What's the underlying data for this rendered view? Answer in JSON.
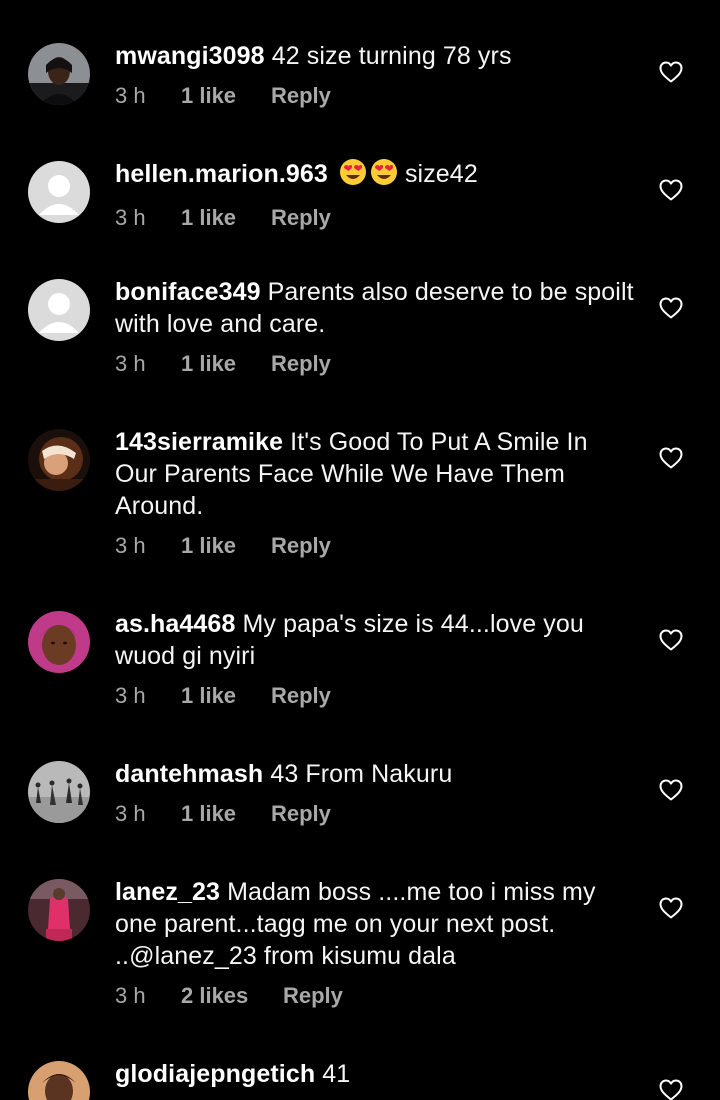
{
  "comments": [
    {
      "username": "mwangi3098",
      "text": "42 size turning 78 yrs",
      "time": "3 h",
      "likes": "1 like",
      "reply": "Reply",
      "avatar_icon": "profile-photo"
    },
    {
      "username": "hellen.marion.963",
      "text": "size42",
      "emojis": [
        "heart-eyes-emoji",
        "heart-eyes-emoji"
      ],
      "time": "3 h",
      "likes": "1 like",
      "reply": "Reply",
      "avatar_icon": "default-avatar"
    },
    {
      "username": "boniface349",
      "text": "Parents also deserve to be spoilt with love and care.",
      "time": "3 h",
      "likes": "1 like",
      "reply": "Reply",
      "avatar_icon": "default-avatar"
    },
    {
      "username": "143sierramike",
      "text": "It's Good To Put A Smile In Our Parents Face While We Have Them Around.",
      "time": "3 h",
      "likes": "1 like",
      "reply": "Reply",
      "avatar_icon": "profile-photo"
    },
    {
      "username": "as.ha4468",
      "text": "My papa's size is 44...love you wuod gi nyiri",
      "time": "3 h",
      "likes": "1 like",
      "reply": "Reply",
      "avatar_icon": "profile-photo"
    },
    {
      "username": "dantehmash",
      "text": "43 From Nakuru",
      "time": "3 h",
      "likes": "1 like",
      "reply": "Reply",
      "avatar_icon": "profile-photo"
    },
    {
      "username": "lanez_23",
      "text": "Madam boss ....me too i miss my one parent...tagg me on your next post. ..@lanez_23 from kisumu dala",
      "time": "3 h",
      "likes": "2 likes",
      "reply": "Reply",
      "avatar_icon": "profile-photo"
    },
    {
      "username": "glodiajepngetich",
      "text": "41",
      "avatar_icon": "profile-photo"
    }
  ],
  "colors": {
    "background": "#000000",
    "text": "#f5f5f5",
    "meta": "#a8a8a8",
    "default_avatar_bg": "#dbdbdb"
  },
  "icons": {
    "like": "heart-outline-icon"
  }
}
